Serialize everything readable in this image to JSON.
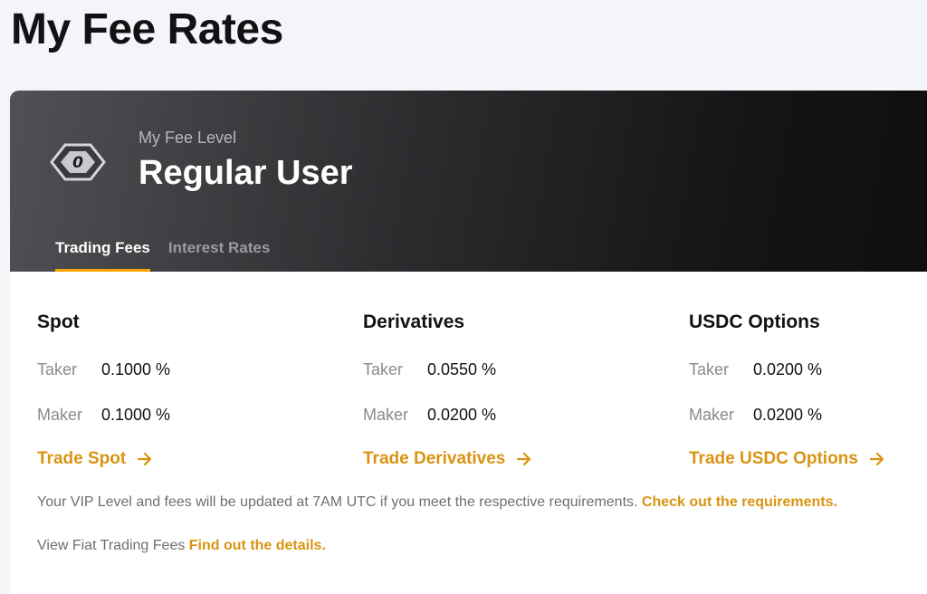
{
  "page": {
    "title": "My Fee Rates"
  },
  "fee_level": {
    "label": "My Fee Level",
    "name": "Regular User",
    "badge_number": "0"
  },
  "tabs": [
    {
      "label": "Trading Fees",
      "active": true
    },
    {
      "label": "Interest Rates",
      "active": false
    }
  ],
  "sections": [
    {
      "title": "Spot",
      "taker_label": "Taker",
      "taker_value": "0.1000 %",
      "maker_label": "Maker",
      "maker_value": "0.1000 %",
      "link": "Trade Spot"
    },
    {
      "title": "Derivatives",
      "taker_label": "Taker",
      "taker_value": "0.0550 %",
      "maker_label": "Maker",
      "maker_value": "0.0200 %",
      "link": "Trade Derivatives"
    },
    {
      "title": "USDC Options",
      "taker_label": "Taker",
      "taker_value": "0.0200 %",
      "maker_label": "Maker",
      "maker_value": "0.0200 %",
      "link": "Trade USDC Options"
    }
  ],
  "notes": {
    "vip_text": "Your VIP Level and fees will be updated at 7AM UTC if you meet the respective requirements. ",
    "vip_link": "Check out the requirements.",
    "fiat_text": "View Fiat Trading Fees ",
    "fiat_link": "Find out the details."
  },
  "colors": {
    "accent": "#f7a600",
    "link": "#d99412",
    "hero_dark": "#0f0f10"
  },
  "icons": {
    "badge": "diamond-badge-icon",
    "arrow": "arrow-right-icon"
  }
}
